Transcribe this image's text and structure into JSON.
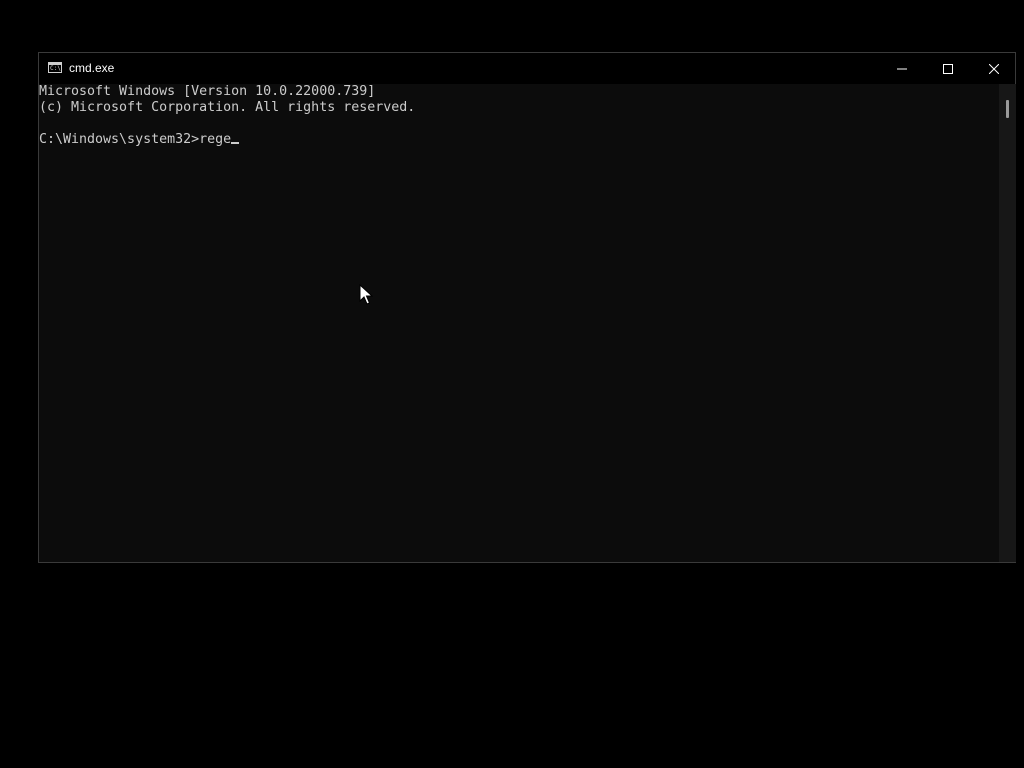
{
  "window": {
    "title": "cmd.exe",
    "icon": "console-app-icon",
    "controls": [
      "minimize-icon",
      "maximize-icon",
      "close-icon"
    ]
  },
  "console": {
    "lines": [
      "Microsoft Windows [Version 10.0.22000.739]",
      "(c) Microsoft Corporation. All rights reserved.",
      "",
      "C:\\Windows\\system32>rege"
    ]
  },
  "colors": {
    "console_background": "#0c0c0c",
    "console_text": "#cccccc",
    "titlebar": "#000000",
    "desktop": "#000000"
  }
}
